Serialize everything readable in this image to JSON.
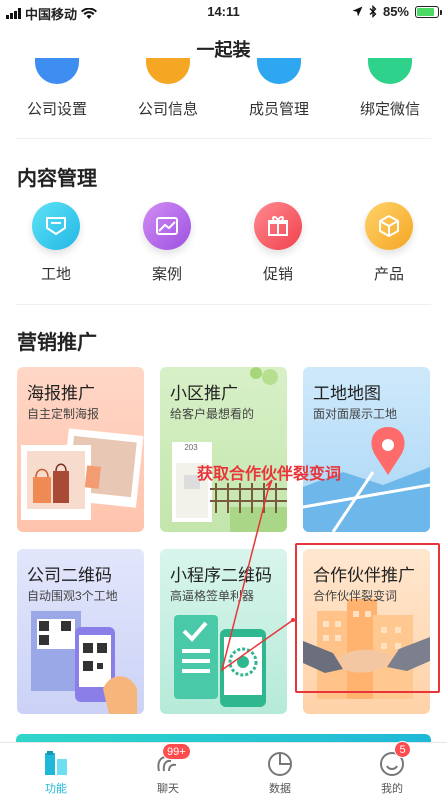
{
  "status_bar": {
    "carrier": "中国移动",
    "time": "14:11",
    "battery": "85%",
    "battery_level": 0.85
  },
  "header": {
    "title": "一起装"
  },
  "top_row": [
    {
      "label": "公司设置",
      "color": "#3d8ef0"
    },
    {
      "label": "公司信息",
      "color": "#f5a623"
    },
    {
      "label": "成员管理",
      "color": "#2fa6f0"
    },
    {
      "label": "绑定微信",
      "color": "#2fd28a"
    }
  ],
  "content_section": {
    "title": "内容管理",
    "items": [
      {
        "label": "工地",
        "icon": "building-site-icon",
        "color": "#2fc4e6"
      },
      {
        "label": "案例",
        "icon": "case-image-icon",
        "color": "#b06ce8"
      },
      {
        "label": "促销",
        "icon": "gift-icon",
        "color": "#ff5e6a"
      },
      {
        "label": "产品",
        "icon": "product-box-icon",
        "color": "#f7b43a"
      }
    ]
  },
  "marketing_section": {
    "title": "营销推广",
    "cards": [
      {
        "title": "海报推广",
        "subtitle": "自主定制海报"
      },
      {
        "title": "小区推广",
        "subtitle": "给客户最想看的",
        "sign": "203"
      },
      {
        "title": "工地地图",
        "subtitle": "面对面展示工地"
      },
      {
        "title": "公司二维码",
        "subtitle": "自动围观3个工地"
      },
      {
        "title": "小程序二维码",
        "subtitle": "高逼格签单利器"
      },
      {
        "title": "合作伙伴推广",
        "subtitle": "合作伙伴裂变词"
      }
    ]
  },
  "annotation": {
    "text": "获取合作伙伴裂变词",
    "color": "#e8353a"
  },
  "tab_bar": {
    "tabs": [
      {
        "label": "功能",
        "active": true
      },
      {
        "label": "聊天",
        "badge": "99+"
      },
      {
        "label": "数据"
      },
      {
        "label": "我的",
        "badge": "5"
      }
    ]
  }
}
